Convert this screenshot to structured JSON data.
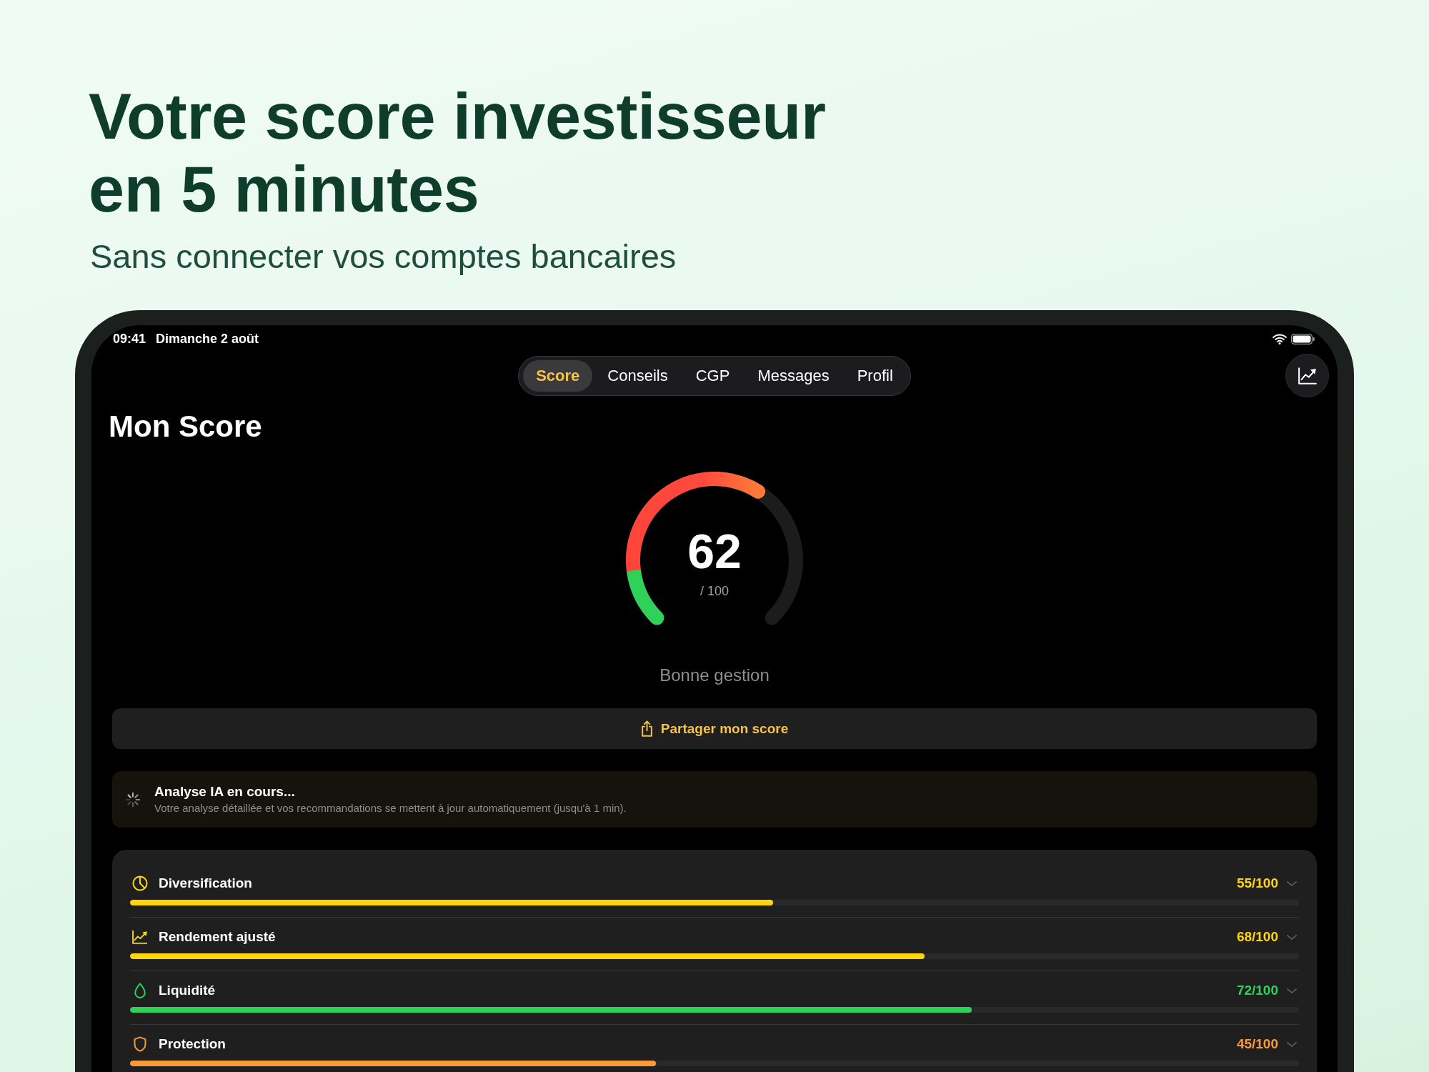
{
  "headline": {
    "lines": [
      "Votre score investisseur",
      "en 5 minutes"
    ]
  },
  "subtitle": "Sans connecter vos comptes bancaires",
  "device": {
    "status_bar": {
      "time": "09:41",
      "date": "Dimanche 2 août"
    },
    "tabs": [
      {
        "label": "Score",
        "selected": true
      },
      {
        "label": "Conseils",
        "selected": false
      },
      {
        "label": "CGP",
        "selected": false
      },
      {
        "label": "Messages",
        "selected": false
      },
      {
        "label": "Profil",
        "selected": false
      }
    ],
    "page_title": "Mon Score",
    "score": {
      "value": "62",
      "max": "/ 100",
      "verdict": "Bonne gestion"
    },
    "share_button": {
      "label": "Partager mon score"
    },
    "ai_notice": {
      "title": "Analyse IA en cours...",
      "text": "Votre analyse détaillée et vos recommandations se mettent à jour automatiquement (jusqu'à 1 min)."
    },
    "criteria": [
      {
        "label": "Diversification",
        "score": "55/100",
        "level": 0.55,
        "color": "#ffd60a",
        "expanded": false
      },
      {
        "label": "Rendement ajusté",
        "score": "68/100",
        "level": 0.68,
        "color": "#ffd60a",
        "expanded": false
      },
      {
        "label": "Liquidité",
        "score": "72/100",
        "level": 0.72,
        "color": "#30d158",
        "expanded": false
      },
      {
        "label": "Protection",
        "score": "45/100",
        "level": 0.45,
        "color": "#fb9a3c",
        "expanded": false
      }
    ]
  }
}
